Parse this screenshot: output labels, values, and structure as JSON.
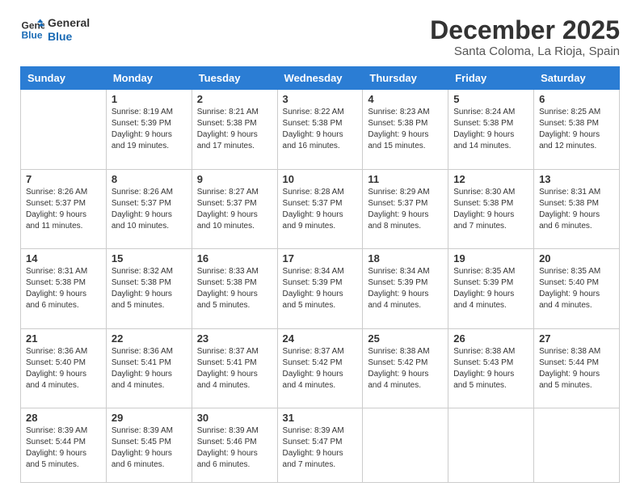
{
  "header": {
    "logo_line1": "General",
    "logo_line2": "Blue",
    "month_title": "December 2025",
    "location": "Santa Coloma, La Rioja, Spain"
  },
  "days_of_week": [
    "Sunday",
    "Monday",
    "Tuesday",
    "Wednesday",
    "Thursday",
    "Friday",
    "Saturday"
  ],
  "weeks": [
    [
      {
        "num": "",
        "info": ""
      },
      {
        "num": "1",
        "info": "Sunrise: 8:19 AM\nSunset: 5:39 PM\nDaylight: 9 hours\nand 19 minutes."
      },
      {
        "num": "2",
        "info": "Sunrise: 8:21 AM\nSunset: 5:38 PM\nDaylight: 9 hours\nand 17 minutes."
      },
      {
        "num": "3",
        "info": "Sunrise: 8:22 AM\nSunset: 5:38 PM\nDaylight: 9 hours\nand 16 minutes."
      },
      {
        "num": "4",
        "info": "Sunrise: 8:23 AM\nSunset: 5:38 PM\nDaylight: 9 hours\nand 15 minutes."
      },
      {
        "num": "5",
        "info": "Sunrise: 8:24 AM\nSunset: 5:38 PM\nDaylight: 9 hours\nand 14 minutes."
      },
      {
        "num": "6",
        "info": "Sunrise: 8:25 AM\nSunset: 5:38 PM\nDaylight: 9 hours\nand 12 minutes."
      }
    ],
    [
      {
        "num": "7",
        "info": "Sunrise: 8:26 AM\nSunset: 5:37 PM\nDaylight: 9 hours\nand 11 minutes."
      },
      {
        "num": "8",
        "info": "Sunrise: 8:26 AM\nSunset: 5:37 PM\nDaylight: 9 hours\nand 10 minutes."
      },
      {
        "num": "9",
        "info": "Sunrise: 8:27 AM\nSunset: 5:37 PM\nDaylight: 9 hours\nand 10 minutes."
      },
      {
        "num": "10",
        "info": "Sunrise: 8:28 AM\nSunset: 5:37 PM\nDaylight: 9 hours\nand 9 minutes."
      },
      {
        "num": "11",
        "info": "Sunrise: 8:29 AM\nSunset: 5:37 PM\nDaylight: 9 hours\nand 8 minutes."
      },
      {
        "num": "12",
        "info": "Sunrise: 8:30 AM\nSunset: 5:38 PM\nDaylight: 9 hours\nand 7 minutes."
      },
      {
        "num": "13",
        "info": "Sunrise: 8:31 AM\nSunset: 5:38 PM\nDaylight: 9 hours\nand 6 minutes."
      }
    ],
    [
      {
        "num": "14",
        "info": "Sunrise: 8:31 AM\nSunset: 5:38 PM\nDaylight: 9 hours\nand 6 minutes."
      },
      {
        "num": "15",
        "info": "Sunrise: 8:32 AM\nSunset: 5:38 PM\nDaylight: 9 hours\nand 5 minutes."
      },
      {
        "num": "16",
        "info": "Sunrise: 8:33 AM\nSunset: 5:38 PM\nDaylight: 9 hours\nand 5 minutes."
      },
      {
        "num": "17",
        "info": "Sunrise: 8:34 AM\nSunset: 5:39 PM\nDaylight: 9 hours\nand 5 minutes."
      },
      {
        "num": "18",
        "info": "Sunrise: 8:34 AM\nSunset: 5:39 PM\nDaylight: 9 hours\nand 4 minutes."
      },
      {
        "num": "19",
        "info": "Sunrise: 8:35 AM\nSunset: 5:39 PM\nDaylight: 9 hours\nand 4 minutes."
      },
      {
        "num": "20",
        "info": "Sunrise: 8:35 AM\nSunset: 5:40 PM\nDaylight: 9 hours\nand 4 minutes."
      }
    ],
    [
      {
        "num": "21",
        "info": "Sunrise: 8:36 AM\nSunset: 5:40 PM\nDaylight: 9 hours\nand 4 minutes."
      },
      {
        "num": "22",
        "info": "Sunrise: 8:36 AM\nSunset: 5:41 PM\nDaylight: 9 hours\nand 4 minutes."
      },
      {
        "num": "23",
        "info": "Sunrise: 8:37 AM\nSunset: 5:41 PM\nDaylight: 9 hours\nand 4 minutes."
      },
      {
        "num": "24",
        "info": "Sunrise: 8:37 AM\nSunset: 5:42 PM\nDaylight: 9 hours\nand 4 minutes."
      },
      {
        "num": "25",
        "info": "Sunrise: 8:38 AM\nSunset: 5:42 PM\nDaylight: 9 hours\nand 4 minutes."
      },
      {
        "num": "26",
        "info": "Sunrise: 8:38 AM\nSunset: 5:43 PM\nDaylight: 9 hours\nand 5 minutes."
      },
      {
        "num": "27",
        "info": "Sunrise: 8:38 AM\nSunset: 5:44 PM\nDaylight: 9 hours\nand 5 minutes."
      }
    ],
    [
      {
        "num": "28",
        "info": "Sunrise: 8:39 AM\nSunset: 5:44 PM\nDaylight: 9 hours\nand 5 minutes."
      },
      {
        "num": "29",
        "info": "Sunrise: 8:39 AM\nSunset: 5:45 PM\nDaylight: 9 hours\nand 6 minutes."
      },
      {
        "num": "30",
        "info": "Sunrise: 8:39 AM\nSunset: 5:46 PM\nDaylight: 9 hours\nand 6 minutes."
      },
      {
        "num": "31",
        "info": "Sunrise: 8:39 AM\nSunset: 5:47 PM\nDaylight: 9 hours\nand 7 minutes."
      },
      {
        "num": "",
        "info": ""
      },
      {
        "num": "",
        "info": ""
      },
      {
        "num": "",
        "info": ""
      }
    ]
  ]
}
